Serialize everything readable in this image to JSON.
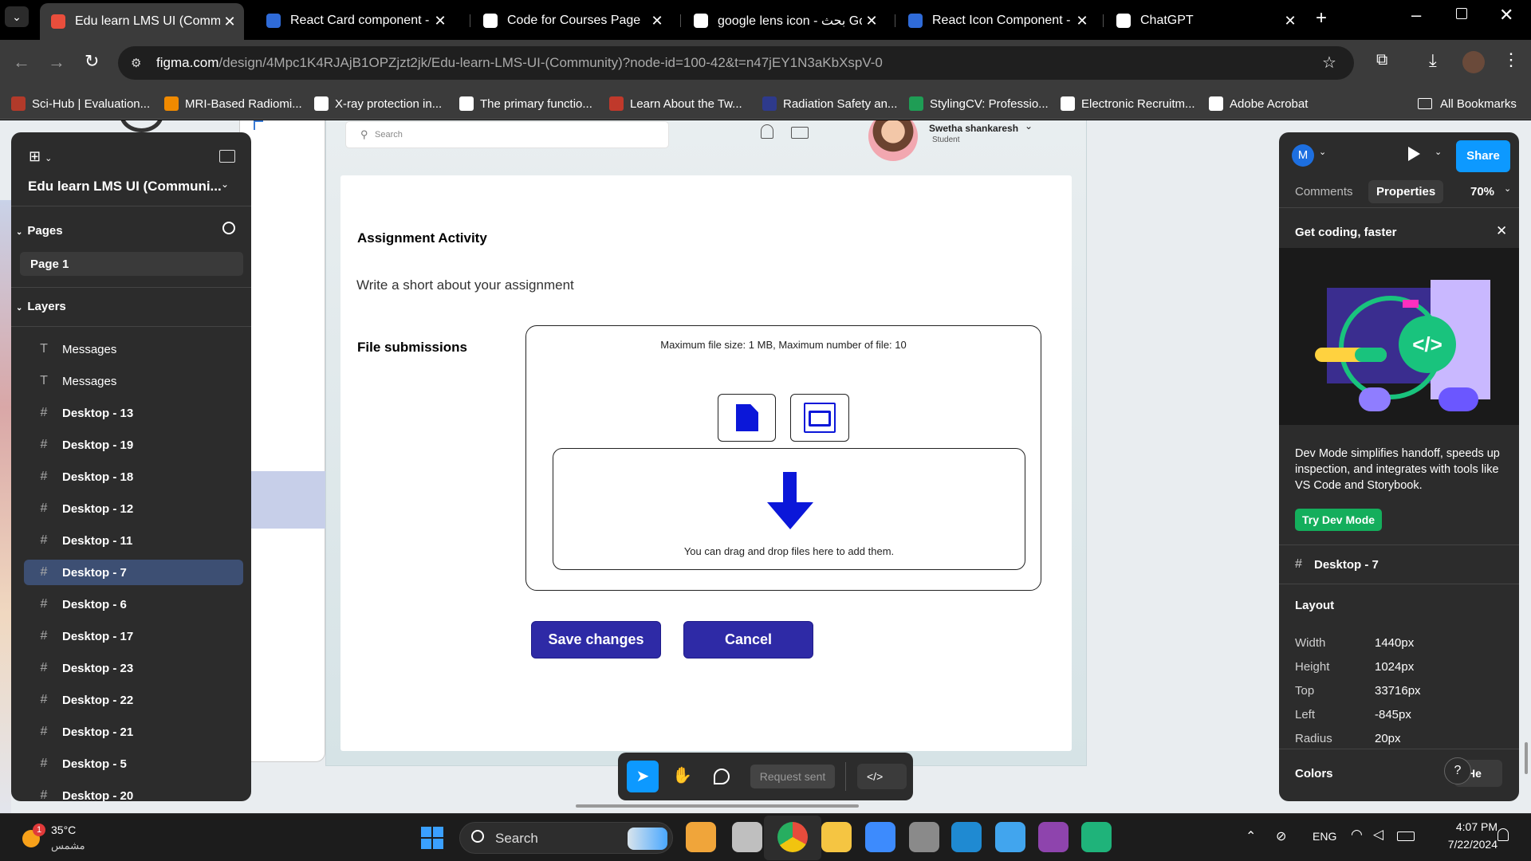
{
  "browser": {
    "tabs": [
      {
        "title": "Edu learn LMS UI (Community)",
        "active": true,
        "icon_color": "#e94e3c"
      },
      {
        "title": "React Card component - Jo",
        "active": false,
        "icon_color": "#2f6bd8"
      },
      {
        "title": "Code for Courses Page",
        "active": false,
        "icon_color": "#ffffff"
      },
      {
        "title": "google lens icon - بحث Go",
        "active": false,
        "icon_color": "#ffffff"
      },
      {
        "title": "React Icon Component - M",
        "active": false,
        "icon_color": "#2f6bd8"
      },
      {
        "title": "ChatGPT",
        "active": false,
        "icon_color": "#ffffff"
      }
    ],
    "url_host": "figma.com",
    "url_path": "/design/4Mpc1K4RJAjB1OPZjzt2jk/Edu-learn-LMS-UI-(Community)?node-id=100-42&t=n47jEY1N3aKbXspV-0",
    "bookmarks": [
      {
        "label": "Sci-Hub | Evaluation...",
        "icon_color": "#b23a2a"
      },
      {
        "label": "MRI-Based Radiomi...",
        "icon_color": "#f08a00"
      },
      {
        "label": "X-ray protection in...",
        "icon_color": "#ffffff"
      },
      {
        "label": "The primary functio...",
        "icon_color": "#ffffff"
      },
      {
        "label": "Learn About the Tw...",
        "icon_color": "#c0392b"
      },
      {
        "label": "Radiation Safety an...",
        "icon_color": "#2e3a8c"
      },
      {
        "label": "StylingCV: Professio...",
        "icon_color": "#1f9d55"
      },
      {
        "label": "Electronic Recruitm...",
        "icon_color": "#ffffff"
      },
      {
        "label": "Adobe Acrobat",
        "icon_color": "#ffffff"
      }
    ],
    "all_bookmarks": "All Bookmarks"
  },
  "figma_left": {
    "file_name": "Edu learn LMS UI (Communi...",
    "pages_heading": "Pages",
    "page_item": "Page 1",
    "layers_heading": "Layers",
    "layers": [
      {
        "name": "Messages",
        "type": "text",
        "selected": false
      },
      {
        "name": "Messages",
        "type": "text",
        "selected": false
      },
      {
        "name": "Desktop - 13",
        "type": "frame",
        "selected": false
      },
      {
        "name": "Desktop - 19",
        "type": "frame",
        "selected": false
      },
      {
        "name": "Desktop - 18",
        "type": "frame",
        "selected": false
      },
      {
        "name": "Desktop - 12",
        "type": "frame",
        "selected": false
      },
      {
        "name": "Desktop - 11",
        "type": "frame",
        "selected": false
      },
      {
        "name": "Desktop - 7",
        "type": "frame",
        "selected": true
      },
      {
        "name": "Desktop - 6",
        "type": "frame",
        "selected": false
      },
      {
        "name": "Desktop - 17",
        "type": "frame",
        "selected": false
      },
      {
        "name": "Desktop - 23",
        "type": "frame",
        "selected": false
      },
      {
        "name": "Desktop - 22",
        "type": "frame",
        "selected": false
      },
      {
        "name": "Desktop - 21",
        "type": "frame",
        "selected": false
      },
      {
        "name": "Desktop - 5",
        "type": "frame",
        "selected": false
      },
      {
        "name": "Desktop - 20",
        "type": "frame",
        "selected": false
      }
    ]
  },
  "design": {
    "search_placeholder": "Search",
    "user_name": "Swetha shankaresh",
    "user_role": "Student",
    "assignment_title": "Assignment Activity",
    "assignment_desc": "Write a short about your assignment",
    "file_submissions": "File submissions",
    "file_limits": "Maximum file size: 1 MB, Maximum number of file: 10",
    "drop_text": "You can drag and drop files here to add them.",
    "save_label": "Save changes",
    "cancel_label": "Cancel"
  },
  "toolbar": {
    "request_sent": "Request sent"
  },
  "figma_right": {
    "avatar_letter": "M",
    "share_label": "Share",
    "tab_comments": "Comments",
    "tab_properties": "Properties",
    "zoom": "70%",
    "promo_title": "Get coding, faster",
    "promo_text": "Dev Mode simplifies handoff, speeds up inspection, and integrates with tools like VS Code and Storybook.",
    "promo_button": "Try Dev Mode",
    "selected_frame": "Desktop - 7",
    "layout_heading": "Layout",
    "layout": [
      {
        "label": "Width",
        "value": "1440px"
      },
      {
        "label": "Height",
        "value": "1024px"
      },
      {
        "label": "Top",
        "value": "33716px"
      },
      {
        "label": "Left",
        "value": "-845px"
      },
      {
        "label": "Radius",
        "value": "20px"
      }
    ],
    "colors_heading": "Colors",
    "colors_value": "He",
    "help": "?"
  },
  "taskbar": {
    "temperature": "35°C",
    "weather": "مشمس",
    "weather_badge": "1",
    "search": "Search",
    "lang": "ENG",
    "time": "4:07 PM",
    "date": "7/22/2024"
  }
}
